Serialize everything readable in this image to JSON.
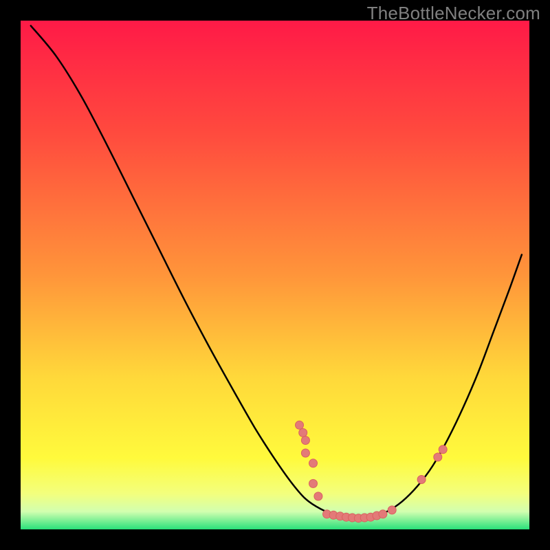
{
  "watermark": "TheBottleNecker.com",
  "colors": {
    "gradient": {
      "g0": "#ff1a47",
      "g1": "#ff4a3e",
      "g2": "#ff953a",
      "g3": "#ffd83a",
      "g4": "#fffa3c",
      "g5": "#f3ff7d",
      "g6": "#d2ffb0",
      "g7": "#29e07a"
    },
    "curve_stroke": "#000000",
    "marker_fill": "#e37a78",
    "marker_stroke": "#d9615f"
  },
  "chart_data": {
    "type": "line",
    "title": "",
    "xlabel": "",
    "ylabel": "",
    "xlim": [
      0,
      1
    ],
    "ylim": [
      0,
      1
    ],
    "note": "Values estimated from pixel positions; origin at top-left of plot area, x right, y down.",
    "curve": [
      {
        "x": 0.02,
        "y": 0.01
      },
      {
        "x": 0.07,
        "y": 0.07
      },
      {
        "x": 0.12,
        "y": 0.15
      },
      {
        "x": 0.17,
        "y": 0.245
      },
      {
        "x": 0.22,
        "y": 0.345
      },
      {
        "x": 0.27,
        "y": 0.445
      },
      {
        "x": 0.32,
        "y": 0.545
      },
      {
        "x": 0.37,
        "y": 0.64
      },
      {
        "x": 0.42,
        "y": 0.73
      },
      {
        "x": 0.46,
        "y": 0.8
      },
      {
        "x": 0.495,
        "y": 0.855
      },
      {
        "x": 0.53,
        "y": 0.905
      },
      {
        "x": 0.56,
        "y": 0.94
      },
      {
        "x": 0.59,
        "y": 0.96
      },
      {
        "x": 0.62,
        "y": 0.972
      },
      {
        "x": 0.655,
        "y": 0.978
      },
      {
        "x": 0.69,
        "y": 0.975
      },
      {
        "x": 0.72,
        "y": 0.965
      },
      {
        "x": 0.75,
        "y": 0.945
      },
      {
        "x": 0.78,
        "y": 0.915
      },
      {
        "x": 0.81,
        "y": 0.875
      },
      {
        "x": 0.84,
        "y": 0.822
      },
      {
        "x": 0.87,
        "y": 0.76
      },
      {
        "x": 0.9,
        "y": 0.69
      },
      {
        "x": 0.93,
        "y": 0.61
      },
      {
        "x": 0.96,
        "y": 0.53
      },
      {
        "x": 0.985,
        "y": 0.46
      }
    ],
    "markers": [
      {
        "x": 0.548,
        "y": 0.795,
        "r": 6
      },
      {
        "x": 0.555,
        "y": 0.81,
        "r": 6
      },
      {
        "x": 0.56,
        "y": 0.825,
        "r": 6
      },
      {
        "x": 0.56,
        "y": 0.85,
        "r": 6
      },
      {
        "x": 0.575,
        "y": 0.87,
        "r": 6
      },
      {
        "x": 0.575,
        "y": 0.91,
        "r": 6
      },
      {
        "x": 0.585,
        "y": 0.935,
        "r": 6
      },
      {
        "x": 0.602,
        "y": 0.97,
        "r": 6
      },
      {
        "x": 0.615,
        "y": 0.972,
        "r": 6
      },
      {
        "x": 0.628,
        "y": 0.974,
        "r": 6
      },
      {
        "x": 0.64,
        "y": 0.976,
        "r": 6
      },
      {
        "x": 0.652,
        "y": 0.977,
        "r": 6
      },
      {
        "x": 0.664,
        "y": 0.978,
        "r": 6
      },
      {
        "x": 0.676,
        "y": 0.977,
        "r": 6
      },
      {
        "x": 0.688,
        "y": 0.976,
        "r": 6
      },
      {
        "x": 0.7,
        "y": 0.973,
        "r": 6
      },
      {
        "x": 0.712,
        "y": 0.97,
        "r": 6
      },
      {
        "x": 0.73,
        "y": 0.962,
        "r": 6
      },
      {
        "x": 0.788,
        "y": 0.902,
        "r": 6
      },
      {
        "x": 0.82,
        "y": 0.858,
        "r": 6
      },
      {
        "x": 0.83,
        "y": 0.843,
        "r": 6
      }
    ]
  }
}
